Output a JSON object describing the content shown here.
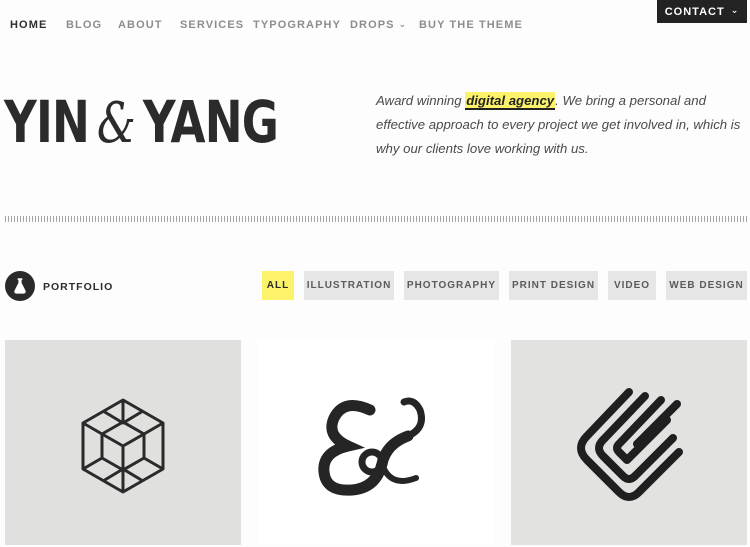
{
  "nav": {
    "items": [
      {
        "label": "HOME",
        "active": true
      },
      {
        "label": "BLOG"
      },
      {
        "label": "ABOUT"
      },
      {
        "label": "SERVICES"
      },
      {
        "label": "TYPOGRAPHY"
      },
      {
        "label": "DROPS"
      },
      {
        "label": "BUY THE THEME"
      }
    ],
    "contact_label": "CONTACT"
  },
  "hero": {
    "logo_left": "YIN",
    "logo_amp": "&",
    "logo_right": "YANG",
    "tagline_pre": "Award winning ",
    "tagline_highlight": "digital agency",
    "tagline_post": ". We bring a personal and effective approach to every project we get involved in, which is why our clients love working with us."
  },
  "portfolio": {
    "label": "PORTFOLIO",
    "icon": "flask-icon",
    "filters": [
      "ALL",
      "ILLUSTRATION",
      "PHOTOGRAPHY",
      "PRINT DESIGN",
      "VIDEO",
      "WEB DESIGN"
    ],
    "active_filter": "ALL"
  },
  "colors": {
    "accent": "#fcf36a",
    "dark": "#232323",
    "filter_bg": "#e6e6e6"
  }
}
